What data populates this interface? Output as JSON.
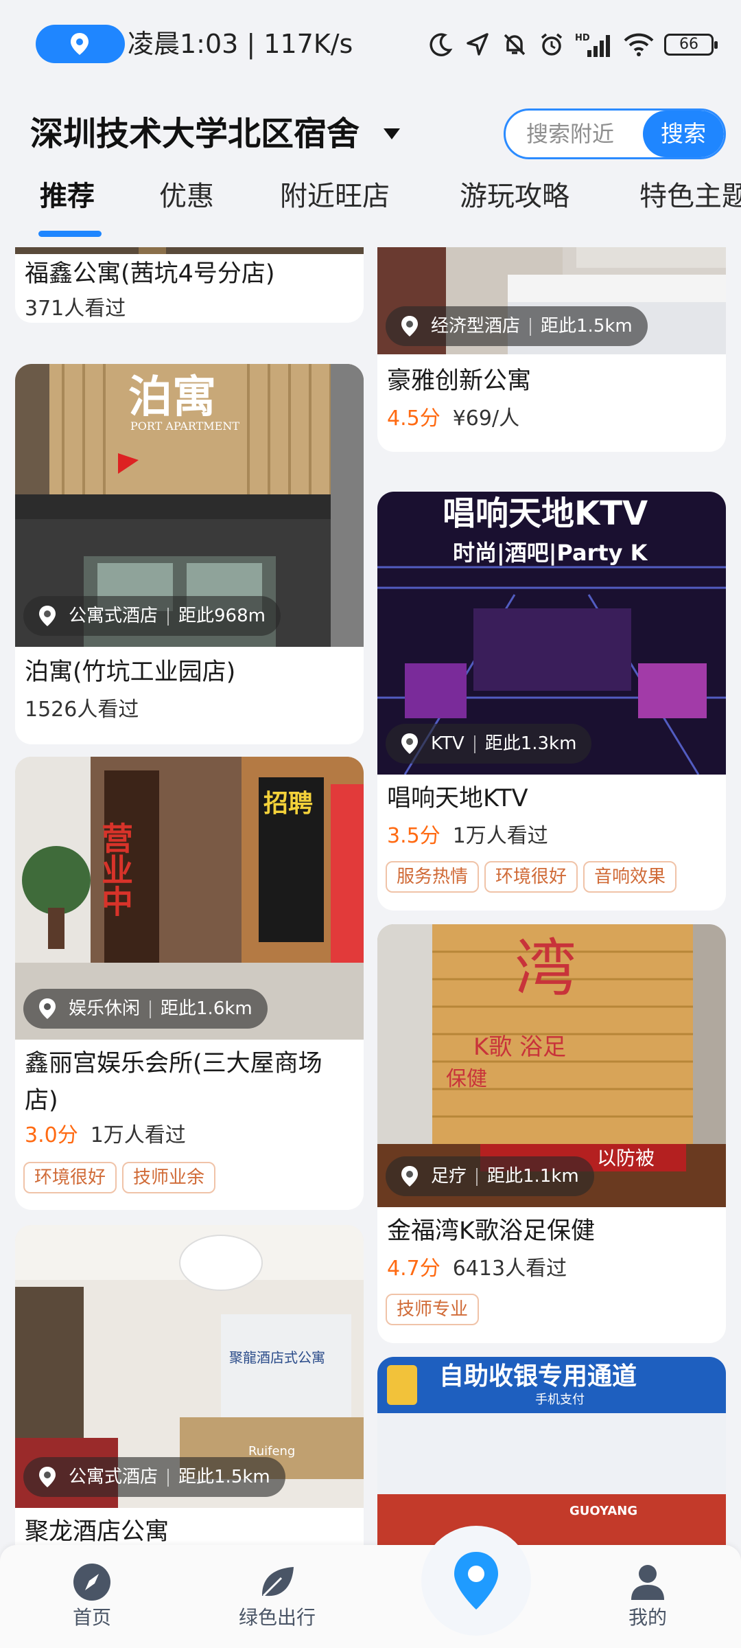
{
  "status_bar": {
    "time_text": "凌晨1:03 | 117K/s",
    "battery": "66",
    "icons": [
      "location-pin-icon",
      "moon-icon",
      "navigation-arrow-icon",
      "bell-muted-icon",
      "alarm-icon",
      "hd-signal-icon",
      "wifi-icon",
      "battery-icon"
    ]
  },
  "header": {
    "location": "深圳技术大学北区宿舍",
    "search_placeholder": "搜索附近",
    "search_button": "搜索"
  },
  "tabs": [
    "推荐",
    "优惠",
    "附近旺店",
    "游玩攻略",
    "特色主题"
  ],
  "active_tab": "推荐",
  "cards": {
    "c1": {
      "title": "福鑫公寓(茜坑4号分店)",
      "meta": "371人看过"
    },
    "c2": {
      "category": "公寓式酒店",
      "distance": "距此968m",
      "title": "泊寓(竹坑工业园店)",
      "meta": "1526人看过"
    },
    "c3": {
      "category": "娱乐休闲",
      "distance": "距此1.6km",
      "title": "鑫丽宫娱乐会所(三大屋商场店)",
      "score": "3.0分",
      "meta": "1万人看过",
      "tags": [
        "环境很好",
        "技师业余"
      ]
    },
    "c4": {
      "category": "公寓式酒店",
      "distance": "距此1.5km",
      "title": "聚龙酒店公寓"
    },
    "c5": {
      "category": "经济型酒店",
      "distance": "距此1.5km",
      "title": "豪雅创新公寓",
      "score": "4.5分",
      "meta": "¥69/人"
    },
    "c6": {
      "category": "KTV",
      "distance": "距此1.3km",
      "title": "唱响天地KTV",
      "score": "3.5分",
      "meta": "1万人看过",
      "tags": [
        "服务热情",
        "环境很好",
        "音响效果"
      ]
    },
    "c7": {
      "category": "足疗",
      "distance": "距此1.1km",
      "title": "金福湾K歌浴足保健",
      "score": "4.7分",
      "meta": "6413人看过",
      "tags": [
        "技师专业"
      ]
    },
    "c8": {}
  },
  "photo_text": {
    "boyu_sign": "泊寓",
    "boyu_sub": "PORT APARTMENT",
    "ktv_sign": "唱响天地KTV",
    "ktv_sub": "时尚|酒吧|Party K",
    "ent_sign": "营业中",
    "ent_poster": "招聘",
    "jinfu_sign": "湾",
    "jinfu_sub1": "K歌 浴足",
    "jinfu_sub2": "保健",
    "jinfu_banner": "以防被",
    "hotel_sign": "聚龍酒店式公寓",
    "hotel_logo": "Ruifeng",
    "market_banner": "自助收银专用通道",
    "market_sub": "手机支付",
    "market_store": "GUOYANG"
  },
  "bottom_nav": [
    {
      "label": "首页",
      "icon": "compass-icon"
    },
    {
      "label": "绿色出行",
      "icon": "leaf-icon"
    },
    {
      "label": "",
      "icon": "location-pin-icon"
    },
    {
      "label": "我的",
      "icon": "user-icon"
    }
  ],
  "colors": {
    "accent": "#1f86ff",
    "score": "#ff6a12",
    "chip_text": "#d06a36",
    "background": "#f2f3f6"
  }
}
